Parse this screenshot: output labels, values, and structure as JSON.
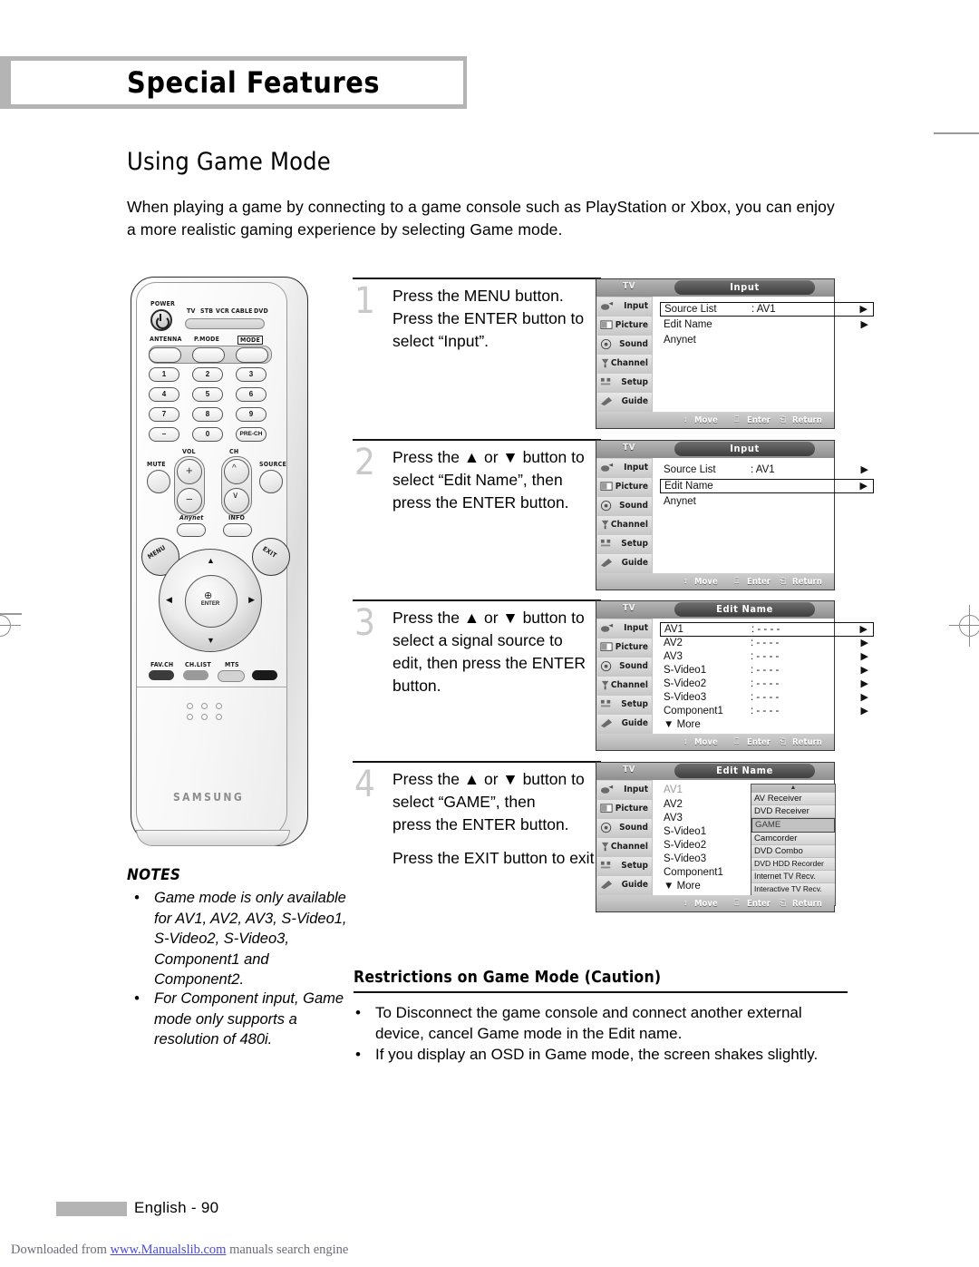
{
  "header": {
    "chapter": "Special Features"
  },
  "page": {
    "title": "Using Game Mode",
    "intro": "When playing a game by connecting to a game console such as PlayStation or Xbox, you can enjoy a more realistic gaming experience by selecting Game mode."
  },
  "remote": {
    "brand": "SAMSUNG",
    "power_label": "POWER",
    "mode_row": [
      "TV",
      "STB",
      "VCR",
      "CABLE",
      "DVD"
    ],
    "fn_labels": [
      "ANTENNA",
      "P.MODE",
      "MODE"
    ],
    "keys": [
      "1",
      "2",
      "3",
      "4",
      "5",
      "6",
      "7",
      "8",
      "9",
      "–",
      "0",
      "PRE-CH"
    ],
    "vol_label": "VOL",
    "ch_label": "CH",
    "mute_label": "MUTE",
    "source_label": "SOURCE",
    "anynet_label": "Anynet",
    "info_label": "INFO",
    "menu_label": "MENU",
    "exit_label": "EXIT",
    "enter_label": "ENTER",
    "bottom_labels": [
      "FAV.CH",
      "CH.LIST",
      "MTS"
    ]
  },
  "steps": [
    {
      "number": "1",
      "lines": [
        "Press the MENU button.",
        "Press the ENTER button to",
        "select “Input”."
      ],
      "extra": ""
    },
    {
      "number": "2",
      "lines": [
        "Press the ▲ or ▼ button to",
        "select “Edit Name”, then",
        "press the ENTER button."
      ],
      "extra": ""
    },
    {
      "number": "3",
      "lines": [
        "Press the ▲ or ▼ button to",
        "select a signal source to",
        "edit, then press the ENTER",
        "button."
      ],
      "extra": ""
    },
    {
      "number": "4",
      "lines": [
        "Press the ▲ or ▼ button to",
        "select “GAME”, then",
        "press the ENTER button."
      ],
      "extra": "Press the EXIT button to exit."
    }
  ],
  "osd_common": {
    "tv_label": "TV",
    "sidebar": [
      "Input",
      "Picture",
      "Sound",
      "Channel",
      "Setup",
      "Guide"
    ],
    "sidebar_icons": [
      "input-icon",
      "picture-icon",
      "sound-icon",
      "channel-icon",
      "setup-icon",
      "guide-icon"
    ],
    "footer": {
      "move": "Move",
      "enter": "Enter",
      "return": "Return"
    }
  },
  "osd_panels": [
    {
      "title": "Input",
      "rows": [
        {
          "name": "Source List",
          "value": ": AV1",
          "arrow": "▶",
          "selected": true
        },
        {
          "name": "Edit Name",
          "value": "",
          "arrow": "▶",
          "selected": false
        },
        {
          "name": "Anynet",
          "value": "",
          "arrow": "",
          "selected": false
        }
      ]
    },
    {
      "title": "Input",
      "rows": [
        {
          "name": "Source List",
          "value": ": AV1",
          "arrow": "▶",
          "selected": false
        },
        {
          "name": "Edit Name",
          "value": "",
          "arrow": "▶",
          "selected": true
        },
        {
          "name": "Anynet",
          "value": "",
          "arrow": "",
          "selected": false
        }
      ]
    },
    {
      "title": "Edit Name",
      "rows": [
        {
          "name": "AV1",
          "value": ": - - - -",
          "arrow": "▶",
          "selected": true
        },
        {
          "name": "AV2",
          "value": ": - - - -",
          "arrow": "▶",
          "selected": false
        },
        {
          "name": "AV3",
          "value": ": - - - -",
          "arrow": "▶",
          "selected": false
        },
        {
          "name": "S-Video1",
          "value": ": - - - -",
          "arrow": "▶",
          "selected": false
        },
        {
          "name": "S-Video2",
          "value": ": - - - -",
          "arrow": "▶",
          "selected": false
        },
        {
          "name": "S-Video3",
          "value": ": - - - -",
          "arrow": "▶",
          "selected": false
        },
        {
          "name": "Component1",
          "value": ": - - - -",
          "arrow": "▶",
          "selected": false
        },
        {
          "name": "▼ More",
          "value": "",
          "arrow": "",
          "selected": false
        }
      ]
    },
    {
      "title": "Edit Name",
      "rows": [
        {
          "name": "AV1",
          "value": "",
          "arrow": "",
          "selected": false,
          "dim": true
        },
        {
          "name": "AV2",
          "value": "",
          "arrow": "",
          "selected": false
        },
        {
          "name": "AV3",
          "value": "",
          "arrow": "",
          "selected": false
        },
        {
          "name": "S-Video1",
          "value": "",
          "arrow": "",
          "selected": false
        },
        {
          "name": "S-Video2",
          "value": "",
          "arrow": "",
          "selected": false
        },
        {
          "name": "S-Video3",
          "value": "",
          "arrow": "",
          "selected": false
        },
        {
          "name": "Component1",
          "value": "",
          "arrow": "",
          "selected": false
        },
        {
          "name": "▼ More",
          "value": "",
          "arrow": "",
          "selected": false
        }
      ],
      "popup": {
        "scroll_up": "▲",
        "scroll_down": "▼",
        "items": [
          {
            "label": "AV Receiver",
            "selected": false
          },
          {
            "label": "DVD Receiver",
            "selected": false
          },
          {
            "label": "GAME",
            "selected": true
          },
          {
            "label": "Camcorder",
            "selected": false
          },
          {
            "label": "DVD Combo",
            "selected": false
          },
          {
            "label": "DVD HDD Recorder",
            "selected": false
          },
          {
            "label": "Internet TV Recv.",
            "selected": false
          },
          {
            "label": "Interactive TV Recv.",
            "selected": false
          }
        ]
      }
    }
  ],
  "notes": {
    "heading": "NOTES",
    "items": [
      "Game mode is only available for AV1, AV2, AV3, S-Video1, S-Video2, S-Video3, Component1 and Component2.",
      "For Component input, Game mode only supports a resolution of 480i."
    ],
    "bullet": "•"
  },
  "restrictions": {
    "title": "Restrictions on Game Mode (Caution)",
    "bullet": "•",
    "items": [
      "To Disconnect the game console and connect another external device, cancel Game mode in the Edit name.",
      "If you display an OSD in Game mode, the screen shakes slightly."
    ]
  },
  "footer": {
    "page_label": "English - 90",
    "download_prefix": "Downloaded from ",
    "download_link": "www.Manualslib.com",
    "download_suffix": " manuals search engine"
  }
}
